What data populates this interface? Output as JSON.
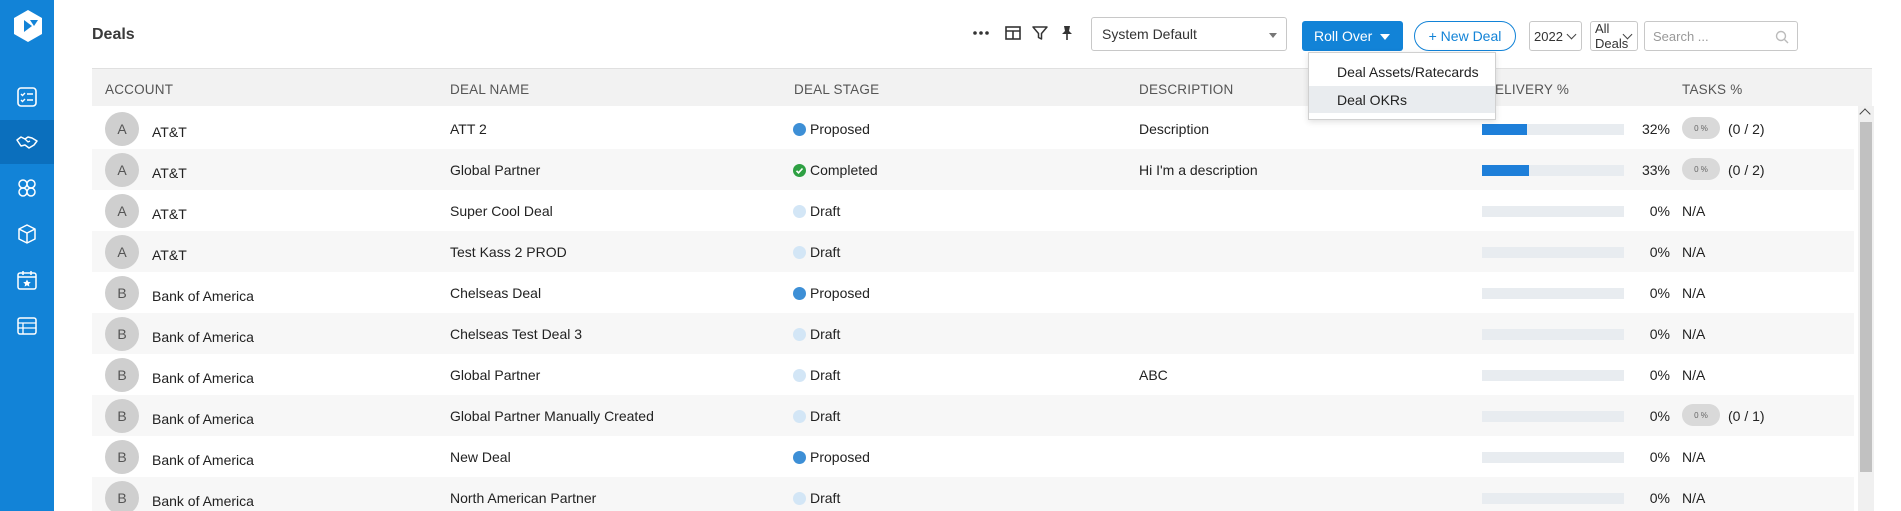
{
  "header": {
    "title": "Deals",
    "view_select": "System Default",
    "rollover_label": "Roll Over",
    "new_deal_label": "+ New Deal",
    "year_select": "2022",
    "deals_filter": "All Deals",
    "search_placeholder": "Search ..."
  },
  "rollover_menu": [
    {
      "label": "Deal Assets/Ratecards"
    },
    {
      "label": "Deal OKRs"
    }
  ],
  "columns": {
    "account": "ACCOUNT",
    "deal_name": "DEAL NAME",
    "deal_stage": "DEAL STAGE",
    "description": "DESCRIPTION",
    "delivery": "DELIVERY %",
    "tasks": "TASKS %"
  },
  "rows": [
    {
      "initial": "A",
      "account": "AT&T",
      "deal_name": "ATT 2",
      "stage": "Proposed",
      "description": "Description",
      "delivery": 32,
      "delivery_label": "32%",
      "task_pct": "0 %",
      "task_count": "(0 / 2)"
    },
    {
      "initial": "A",
      "account": "AT&T",
      "deal_name": "Global Partner",
      "stage": "Completed",
      "description": "Hi I'm a description",
      "delivery": 33,
      "delivery_label": "33%",
      "task_pct": "0 %",
      "task_count": "(0 / 2)"
    },
    {
      "initial": "A",
      "account": "AT&T",
      "deal_name": "Super Cool Deal",
      "stage": "Draft",
      "description": "",
      "delivery": 0,
      "delivery_label": "0%",
      "task_na": "N/A"
    },
    {
      "initial": "A",
      "account": "AT&T",
      "deal_name": "Test Kass 2 PROD",
      "stage": "Draft",
      "description": "",
      "delivery": 0,
      "delivery_label": "0%",
      "task_na": "N/A"
    },
    {
      "initial": "B",
      "account": "Bank of America",
      "deal_name": "Chelseas Deal",
      "stage": "Proposed",
      "description": "",
      "delivery": 0,
      "delivery_label": "0%",
      "task_na": "N/A"
    },
    {
      "initial": "B",
      "account": "Bank of America",
      "deal_name": "Chelseas Test Deal 3",
      "stage": "Draft",
      "description": "",
      "delivery": 0,
      "delivery_label": "0%",
      "task_na": "N/A"
    },
    {
      "initial": "B",
      "account": "Bank of America",
      "deal_name": "Global Partner",
      "stage": "Draft",
      "description": "ABC",
      "delivery": 0,
      "delivery_label": "0%",
      "task_na": "N/A"
    },
    {
      "initial": "B",
      "account": "Bank of America",
      "deal_name": "Global Partner Manually Created",
      "stage": "Draft",
      "description": "",
      "delivery": 0,
      "delivery_label": "0%",
      "task_pct": "0 %",
      "task_count": "(0 / 1)"
    },
    {
      "initial": "B",
      "account": "Bank of America",
      "deal_name": "New Deal",
      "stage": "Proposed",
      "description": "",
      "delivery": 0,
      "delivery_label": "0%",
      "task_na": "N/A"
    },
    {
      "initial": "B",
      "account": "Bank of America",
      "deal_name": "North American Partner",
      "stage": "Draft",
      "description": "",
      "delivery": 0,
      "delivery_label": "0%",
      "task_na": "N/A"
    }
  ],
  "sidebar": {
    "items": [
      {
        "icon": "checklist-icon"
      },
      {
        "icon": "handshake-icon"
      },
      {
        "icon": "groups-icon"
      },
      {
        "icon": "box-icon"
      },
      {
        "icon": "calendar-star-icon"
      },
      {
        "icon": "table-list-icon"
      }
    ]
  },
  "colors": {
    "brand": "#1283d7",
    "proposed": "#3d8fd6",
    "draft": "#d3e6f6",
    "completed": "#2ea043",
    "progress": "#1e7fd9"
  }
}
